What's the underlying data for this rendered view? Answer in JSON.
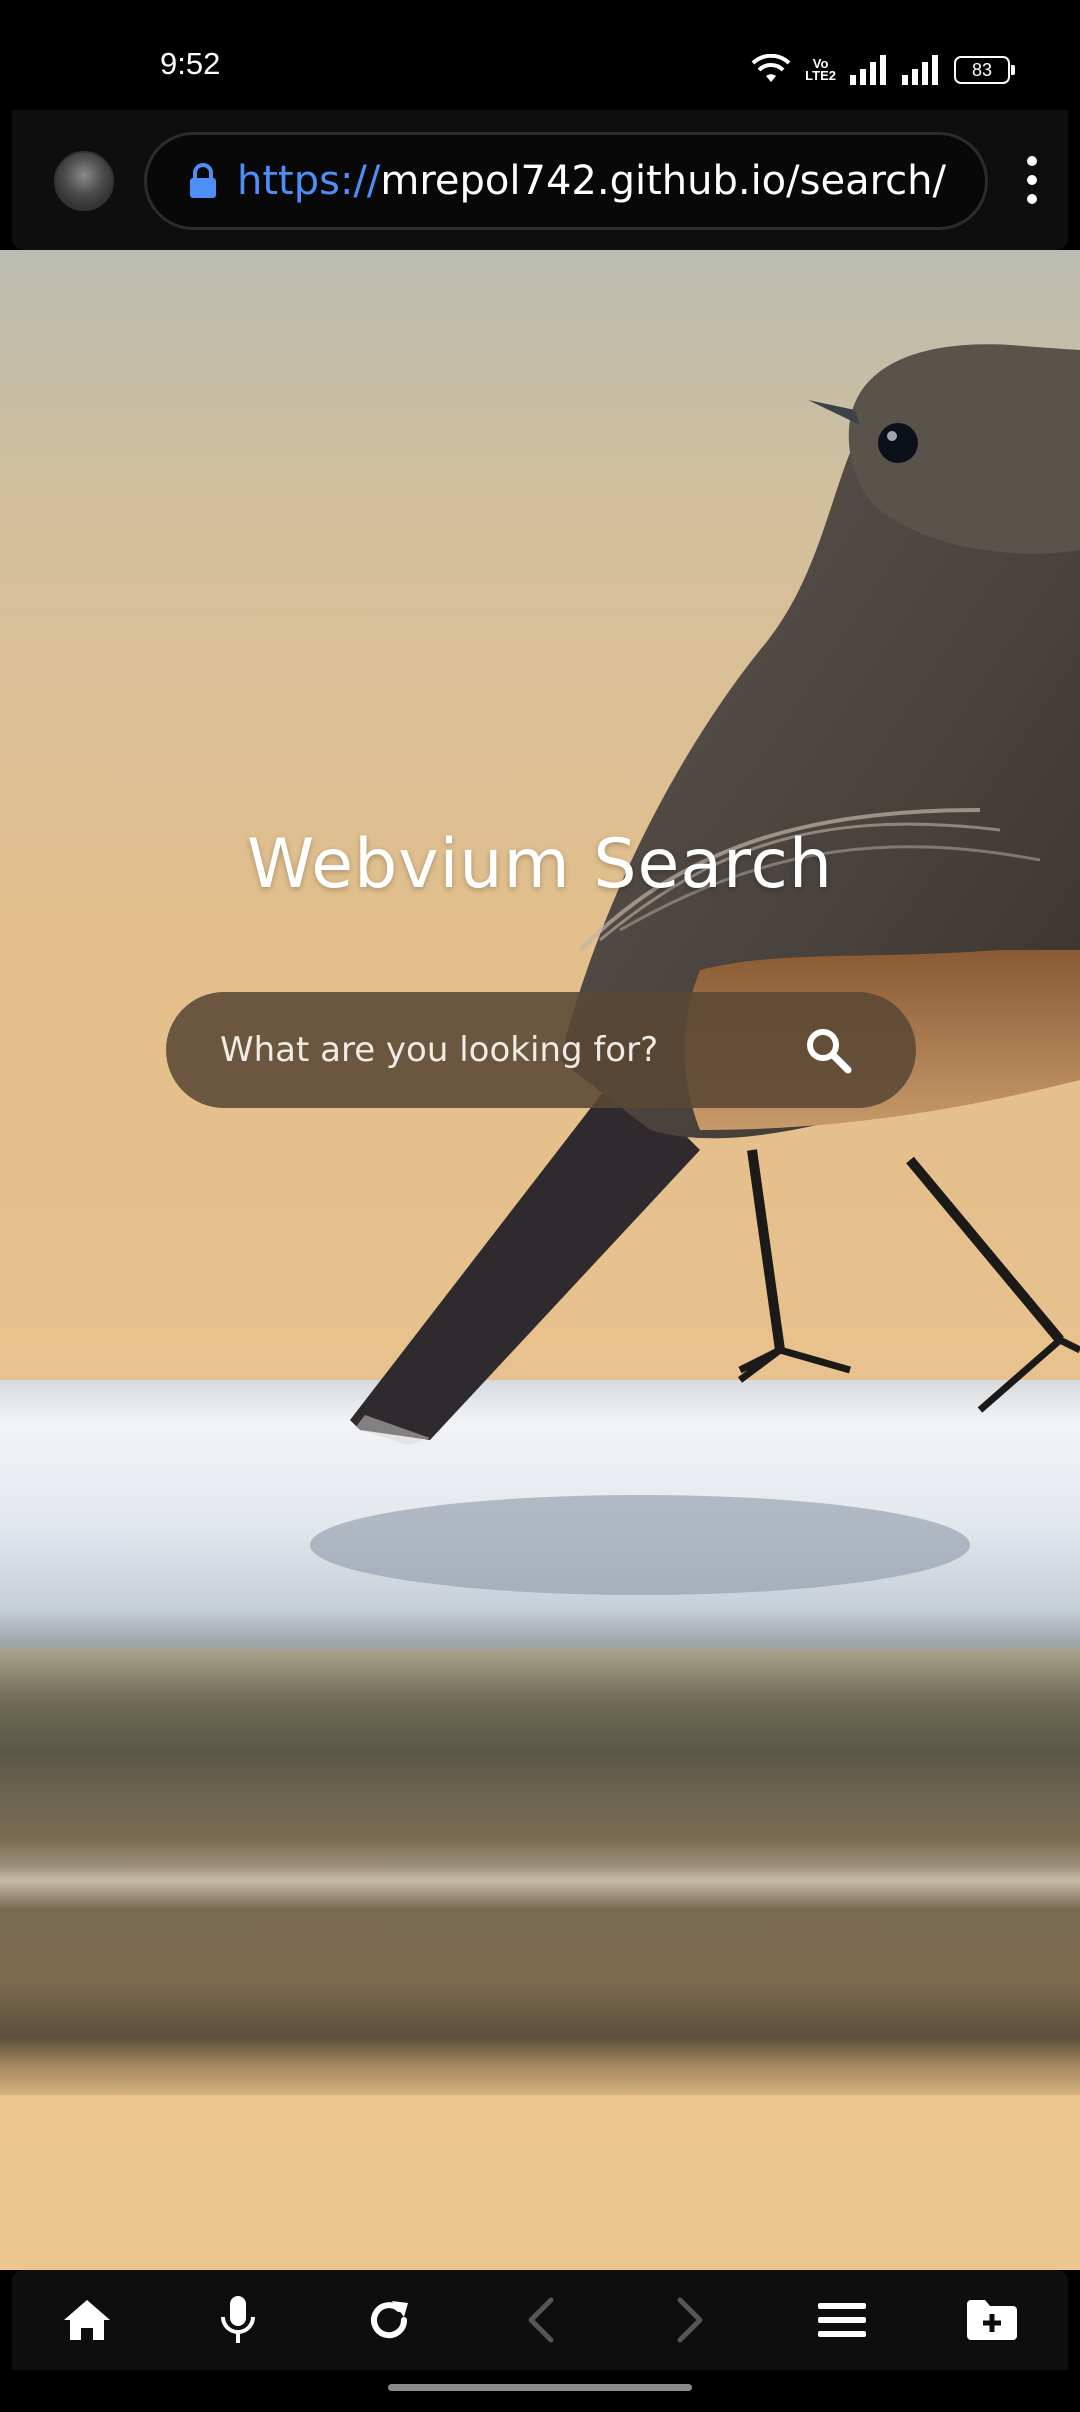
{
  "status_bar": {
    "time": "9:52",
    "battery": "83",
    "icons": [
      "wifi-icon",
      "volte-icon",
      "signal-icon",
      "signal-icon"
    ],
    "volte_top": "Vo",
    "volte_bottom": "LTE2"
  },
  "browser": {
    "url_scheme": "https://",
    "url_rest": "mrepol742.github.io/search/",
    "icons": [
      "avatar",
      "lock-icon",
      "more-vert-icon"
    ],
    "accent_color": "#4d8ef7"
  },
  "page": {
    "title": "Webvium Search",
    "search": {
      "placeholder": "What are you looking for?",
      "value": ""
    }
  },
  "bottom_nav": {
    "items": [
      "home-icon",
      "mic-icon",
      "reload-icon",
      "back-icon",
      "forward-icon",
      "menu-icon",
      "new-folder-icon"
    ],
    "disabled": [
      "back-icon",
      "forward-icon"
    ]
  }
}
